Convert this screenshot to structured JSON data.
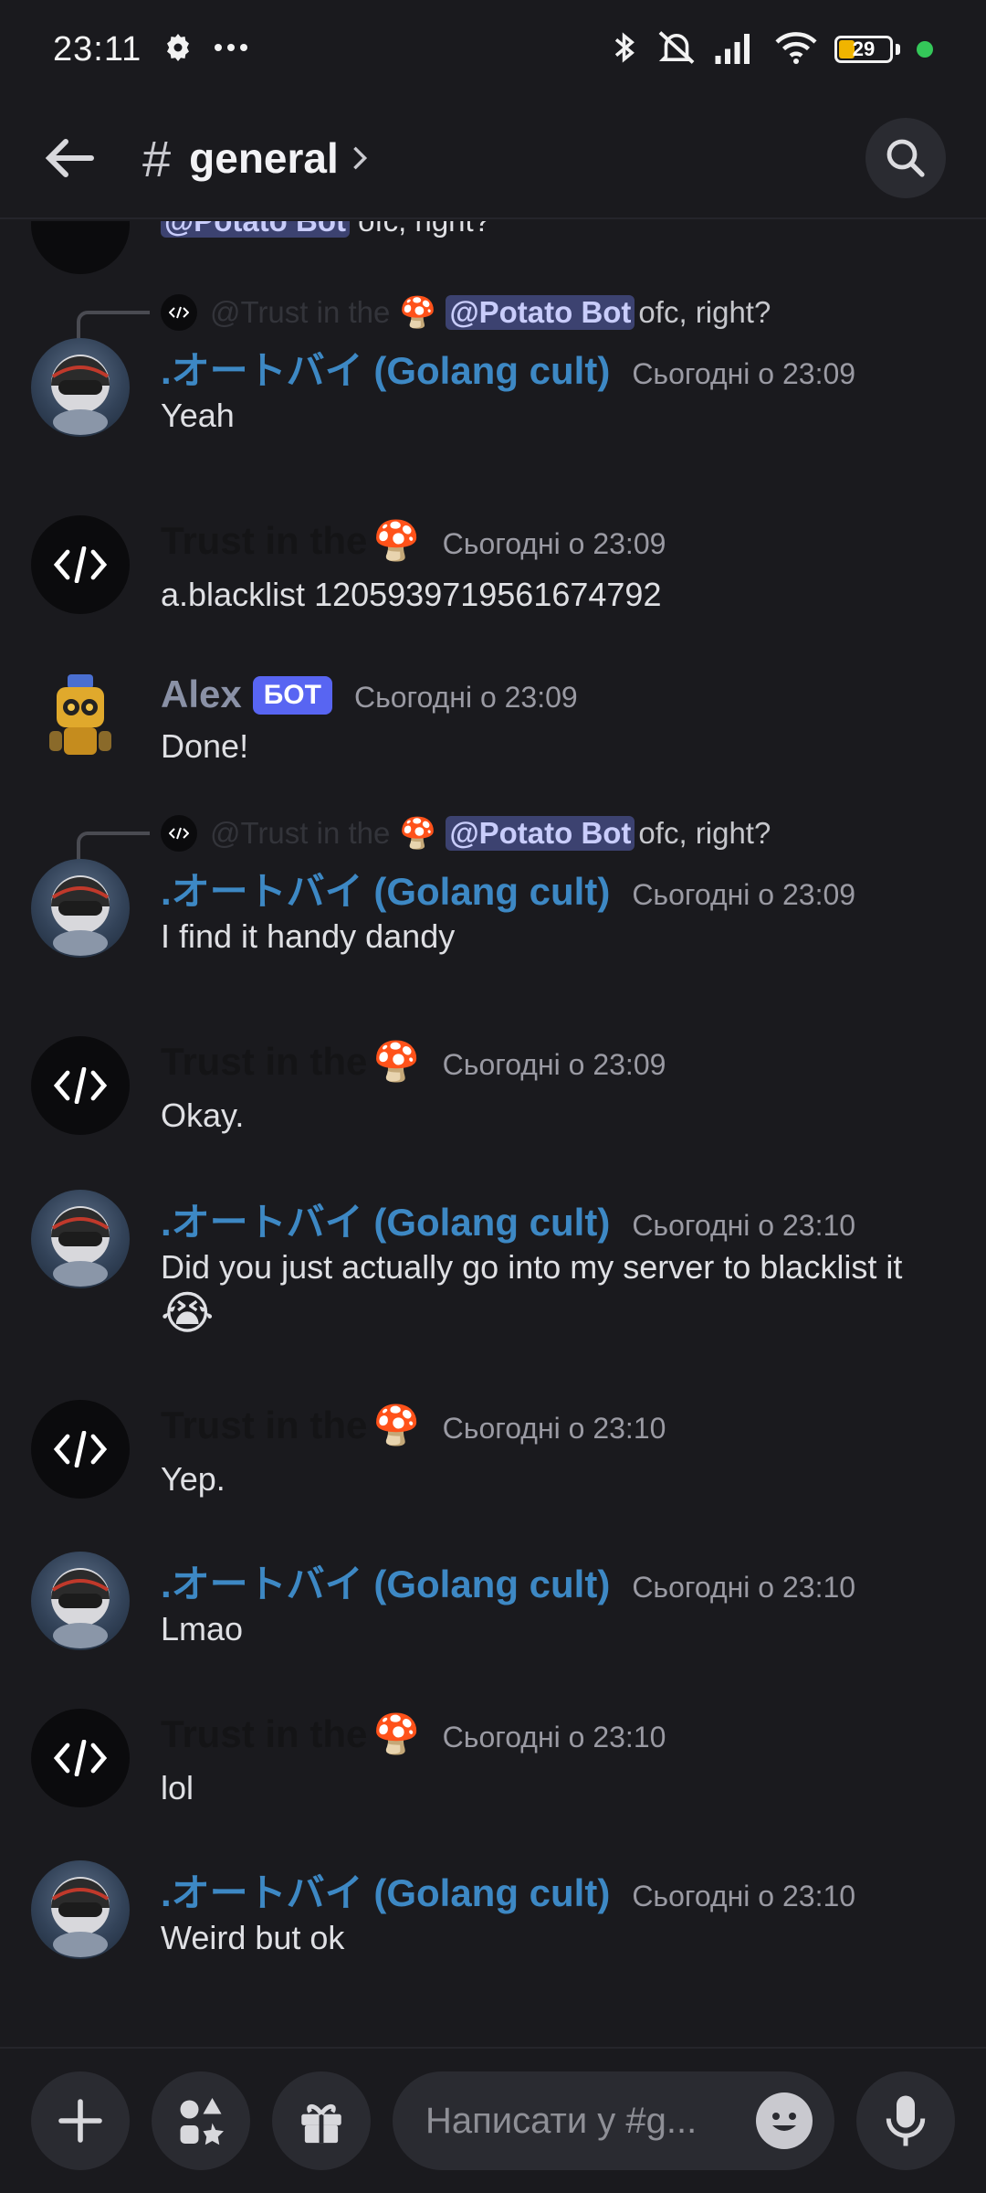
{
  "status_bar": {
    "time": "23:11",
    "battery": "29",
    "icons": [
      "settings-gear-icon",
      "more-dots-icon",
      "bluetooth-icon",
      "mute-bell-icon",
      "signal-icon",
      "wifi-icon",
      "battery-icon",
      "privacy-dot-icon"
    ]
  },
  "header": {
    "hash": "#",
    "channel": "general"
  },
  "messages": [
    {
      "author": "",
      "text_mention": "@Potato Bot",
      "text": " ofc, right?"
    },
    {
      "reply": {
        "author": "@Trust in the",
        "mention": "@Potato Bot",
        "text": "ofc, right?"
      },
      "author": ".オートバイ (Golang cult)",
      "time": "Сьогодні о 23:09",
      "text": "Yeah"
    },
    {
      "author": "Trust in the",
      "time": "Сьогодні о 23:09",
      "text": "a.blacklist 1205939719561674792"
    },
    {
      "author": "Alex",
      "bot_tag": "БОТ",
      "time": "Сьогодні о 23:09",
      "text": "Done!"
    },
    {
      "reply": {
        "author": "@Trust in the",
        "mention": "@Potato Bot",
        "text": "ofc, right?"
      },
      "author": ".オートバイ (Golang cult)",
      "time": "Сьогодні о 23:09",
      "text": "I find it handy dandy"
    },
    {
      "author": "Trust in the",
      "time": "Сьогодні о 23:09",
      "text": "Okay."
    },
    {
      "author": ".オートバイ (Golang cult)",
      "time": "Сьогодні о 23:10",
      "text": "Did you just actually go into my server to blacklist it",
      "emoji": "😭"
    },
    {
      "author": "Trust in the",
      "time": "Сьогодні о 23:10",
      "text": "Yep."
    },
    {
      "author": ".オートバイ (Golang cult)",
      "time": "Сьогодні о 23:10",
      "text": "Lmao"
    },
    {
      "author": "Trust in the",
      "time": "Сьогодні о 23:10",
      "text": "lol"
    },
    {
      "author": ".オートバイ (Golang cult)",
      "time": "Сьогодні о 23:10",
      "text": "Weird but ok"
    }
  ],
  "mushroom_emoji": "🍄",
  "composer": {
    "placeholder": "Написати у #g..."
  },
  "colors": {
    "background": "#1a1a1e",
    "accent": "#5865f2",
    "moto_author": "#3d88c4",
    "mention_bg": "#3c4270"
  }
}
